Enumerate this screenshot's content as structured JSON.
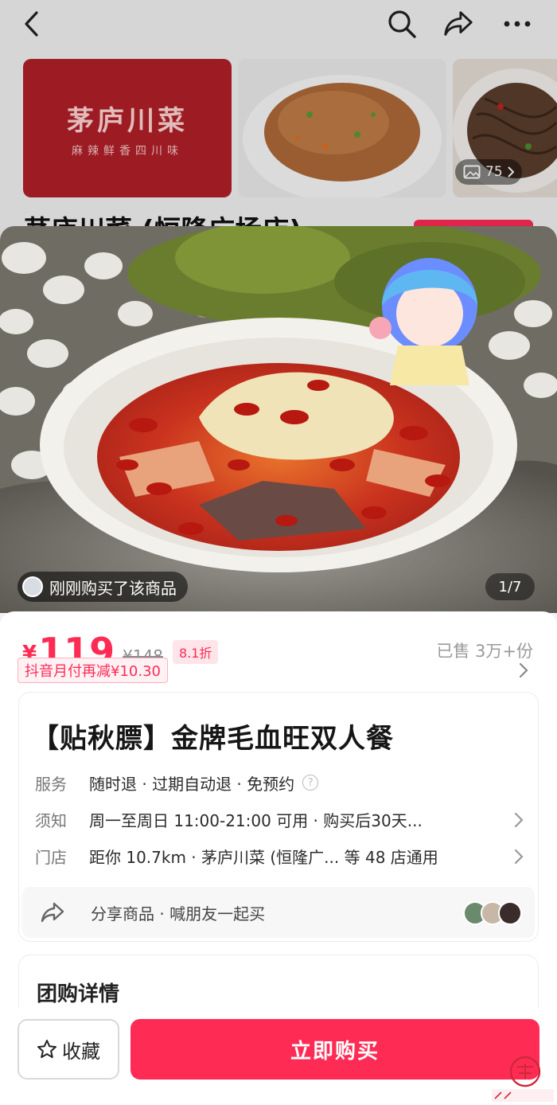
{
  "store": {
    "logo_title": "茅庐川菜",
    "logo_subtitle": "麻辣鲜香四川味",
    "photo_count": "75",
    "title_peek": "茅庐川菜 (恒隆广场店)"
  },
  "hero": {
    "recent_purchase": "刚刚购买了该商品",
    "pager": "1/7"
  },
  "price": {
    "currency": "¥",
    "value": "119",
    "original": "¥148",
    "discount": "8.1折",
    "sold": "已售 3万+份",
    "promo": "抖音月付再减¥10.30"
  },
  "product": {
    "title": "【贴秋膘】金牌毛血旺双人餐",
    "service_label": "服务",
    "service_value": "随时退 · 过期自动退 · 免预约",
    "notice_label": "须知",
    "notice_value": "周一至周日 11:00-21:00 可用 · 购买后30天...",
    "store_label": "门店",
    "store_value": "距你 10.7km · 茅庐川菜 (恒隆广... 等 48 店通用",
    "share_text": "分享商品 · 喊朋友一起买"
  },
  "details": {
    "title": "团购详情"
  },
  "actions": {
    "favorite": "收藏",
    "buy": "立即购买"
  },
  "colors": {
    "accent": "#fe2c55",
    "logo_bg": "#b3202a"
  }
}
